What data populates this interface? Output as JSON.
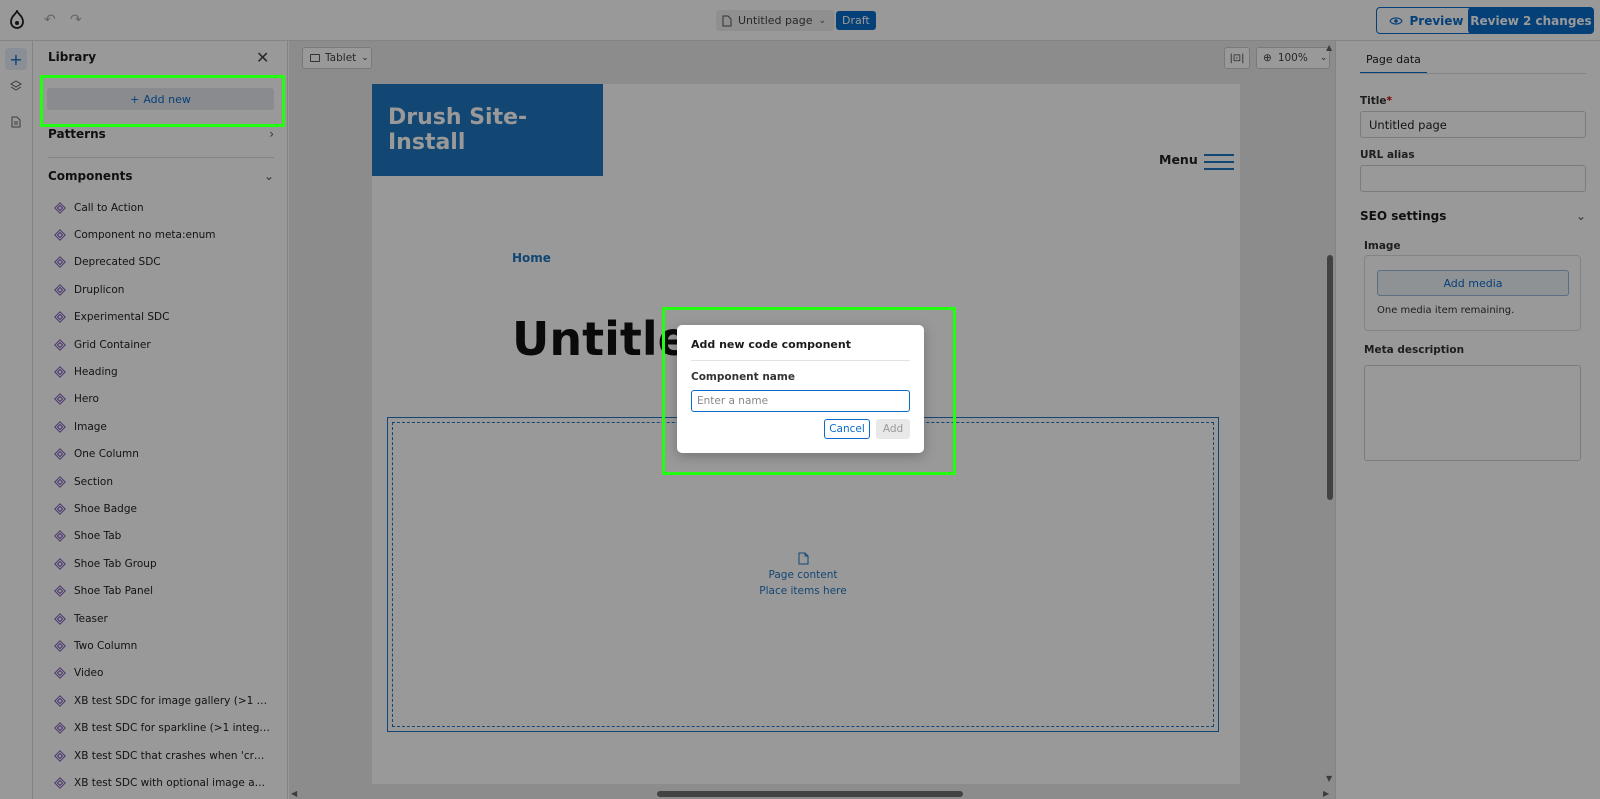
{
  "topbar": {
    "page_select_label": "Untitled page",
    "status_badge": "Draft",
    "preview_label": "Preview",
    "review_label": "Review 2 changes"
  },
  "library": {
    "title": "Library",
    "add_new_label": "Add new",
    "patterns_label": "Patterns",
    "components_label": "Components",
    "components": [
      "Call to Action",
      "Component no meta:enum",
      "Deprecated SDC",
      "Druplicon",
      "Experimental SDC",
      "Grid Container",
      "Heading",
      "Hero",
      "Image",
      "One Column",
      "Section",
      "Shoe Badge",
      "Shoe Tab",
      "Shoe Tab Group",
      "Shoe Tab Panel",
      "Teaser",
      "Two Column",
      "Video",
      "XB test SDC for image gallery (>1 ima...",
      "XB test SDC for sparkline (>1 integer...",
      "XB test SDC that crashes when 'crash...",
      "XB test SDC with optional image and ..."
    ]
  },
  "canvas": {
    "device_label": "Tablet",
    "zoom_label": "100%",
    "site_name": "Drush Site-Install",
    "menu_label": "Menu",
    "breadcrumb_home": "Home",
    "page_heading": "Untitle",
    "dropzone_title": "Page content",
    "dropzone_hint": "Place items here"
  },
  "page_data_panel": {
    "tab_label": "Page data",
    "title_label": "Title",
    "title_required_mark": "*",
    "title_value": "Untitled page",
    "url_alias_label": "URL alias",
    "url_alias_value": "",
    "seo_label": "SEO settings",
    "image_label": "Image",
    "add_media_label": "Add media",
    "media_note": "One media item remaining.",
    "meta_description_label": "Meta description"
  },
  "dialog": {
    "title": "Add new code component",
    "field_label": "Component name",
    "field_placeholder": "Enter a name",
    "cancel_label": "Cancel",
    "add_label": "Add"
  },
  "colors": {
    "accent": "#0a6bc9",
    "site_brand": "#1f76c0",
    "highlight": "#22ff11"
  }
}
